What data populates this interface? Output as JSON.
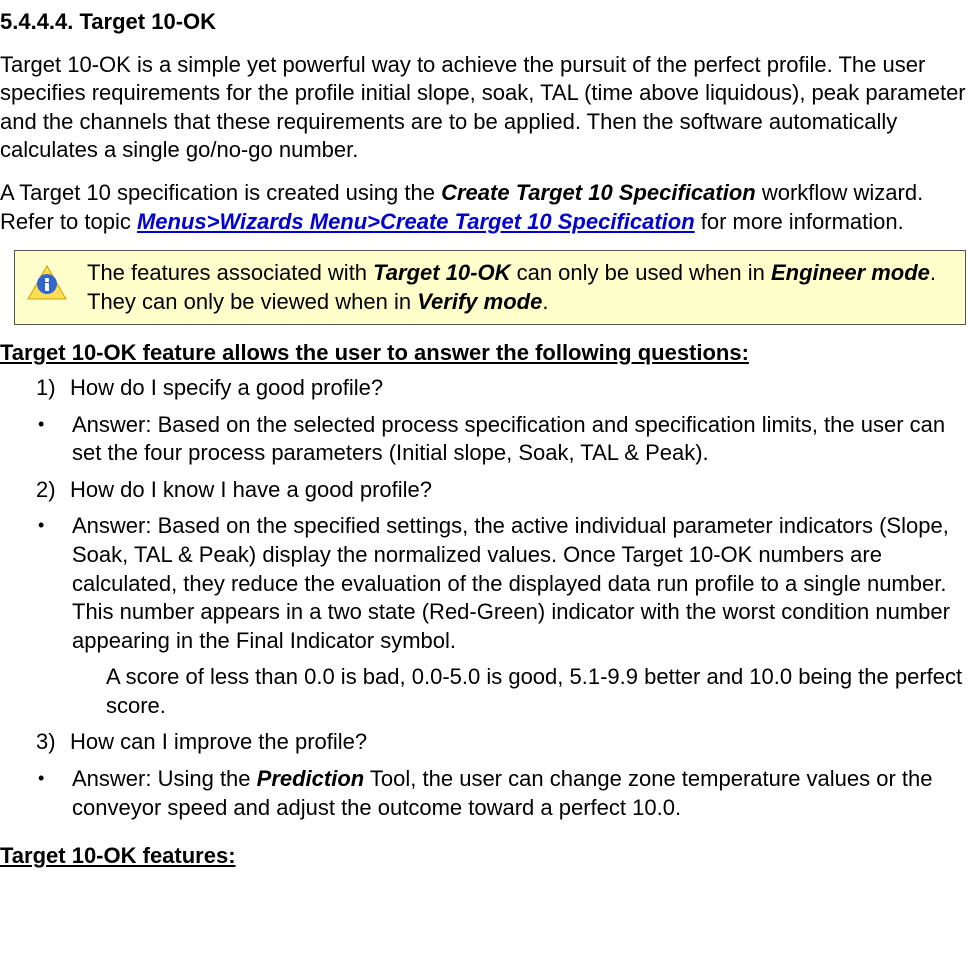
{
  "heading": "5.4.4.4. Target 10-OK",
  "para1": "Target 10-OK is a simple yet powerful way to achieve the pursuit of the perfect profile. The user specifies requirements for the profile   initial slope, soak, TAL (time above liquidous), peak parameter and the channels that these requirements are to be applied. Then the software automatically calculates a single go/no-go number.",
  "para2_pre": "A Target 10 specification is created using the ",
  "para2_b1": "Create Target 10 Specification",
  "para2_mid": " workflow wizard. Refer to topic ",
  "para2_link": "Menus>Wizards Menu>Create Target 10 Specification",
  "para2_post": " for more information.",
  "callout_pre": "The features associated with ",
  "callout_b1": "Target 10-OK",
  "callout_mid1": " can only be used when in ",
  "callout_b2": "Engineer mode",
  "callout_mid2": ". They can only be viewed when in ",
  "callout_b3": "Verify mode",
  "callout_post": ".",
  "subheading": "Target 10-OK feature allows the user to answer the following questions:",
  "q1_marker": "1)",
  "q1_text": "How do I specify a good profile?",
  "a1_text": "Answer: Based on the selected process specification and specification limits, the user can set the four process parameters (Initial slope, Soak, TAL & Peak).",
  "q2_marker": "2)",
  "q2_text": "How do I know I have a good profile?",
  "a2_text": "Answer: Based on the specified settings, the active individual parameter indicators (Slope, Soak, TAL & Peak) display the normalized values. Once Target 10-OK numbers are calculated, they reduce the evaluation of the displayed data run profile to a single number. This number appears in a two state (Red-Green) indicator with the worst condition number appearing in the Final Indicator symbol.",
  "a2_supp": "A score of less than 0.0 is bad, 0.0-5.0 is good, 5.1-9.9 better and 10.0 being the perfect score.",
  "q3_marker": "3)",
  "q3_text": "How can I improve the profile?",
  "a3_pre": "Answer: Using the ",
  "a3_b": "Prediction",
  "a3_post": " Tool, the user can change zone temperature values or the conveyor speed and adjust the outcome toward a perfect 10.0.",
  "features_heading": "Target 10-OK features:",
  "bullet": "•"
}
